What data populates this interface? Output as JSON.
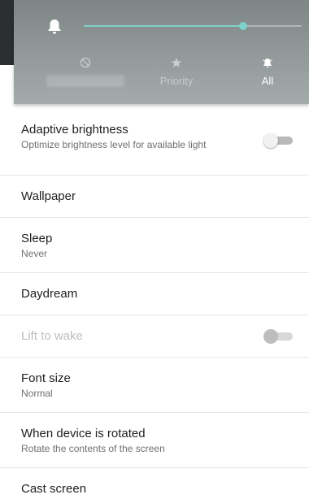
{
  "volume_panel": {
    "level": 0.73,
    "accent_color": "#7fd3cb",
    "icon": "bell-icon",
    "modes": [
      {
        "label": "",
        "icon": "none-icon",
        "active": false
      },
      {
        "label": "Priority",
        "icon": "star-icon",
        "active": false
      },
      {
        "label": "All",
        "icon": "bell-ring-icon",
        "active": true
      }
    ]
  },
  "settings": {
    "adaptive_brightness": {
      "title": "Adaptive brightness",
      "summary": "Optimize brightness level for available light",
      "toggle_on": false
    },
    "wallpaper": {
      "title": "Wallpaper"
    },
    "sleep": {
      "title": "Sleep",
      "summary": "Never"
    },
    "daydream": {
      "title": "Daydream"
    },
    "lift_to_wake": {
      "title": "Lift to wake",
      "toggle_on": false,
      "enabled": false
    },
    "font_size": {
      "title": "Font size",
      "summary": "Normal"
    },
    "rotation": {
      "title": "When device is rotated",
      "summary": "Rotate the contents of the screen"
    },
    "cast_screen": {
      "title": "Cast screen"
    }
  }
}
